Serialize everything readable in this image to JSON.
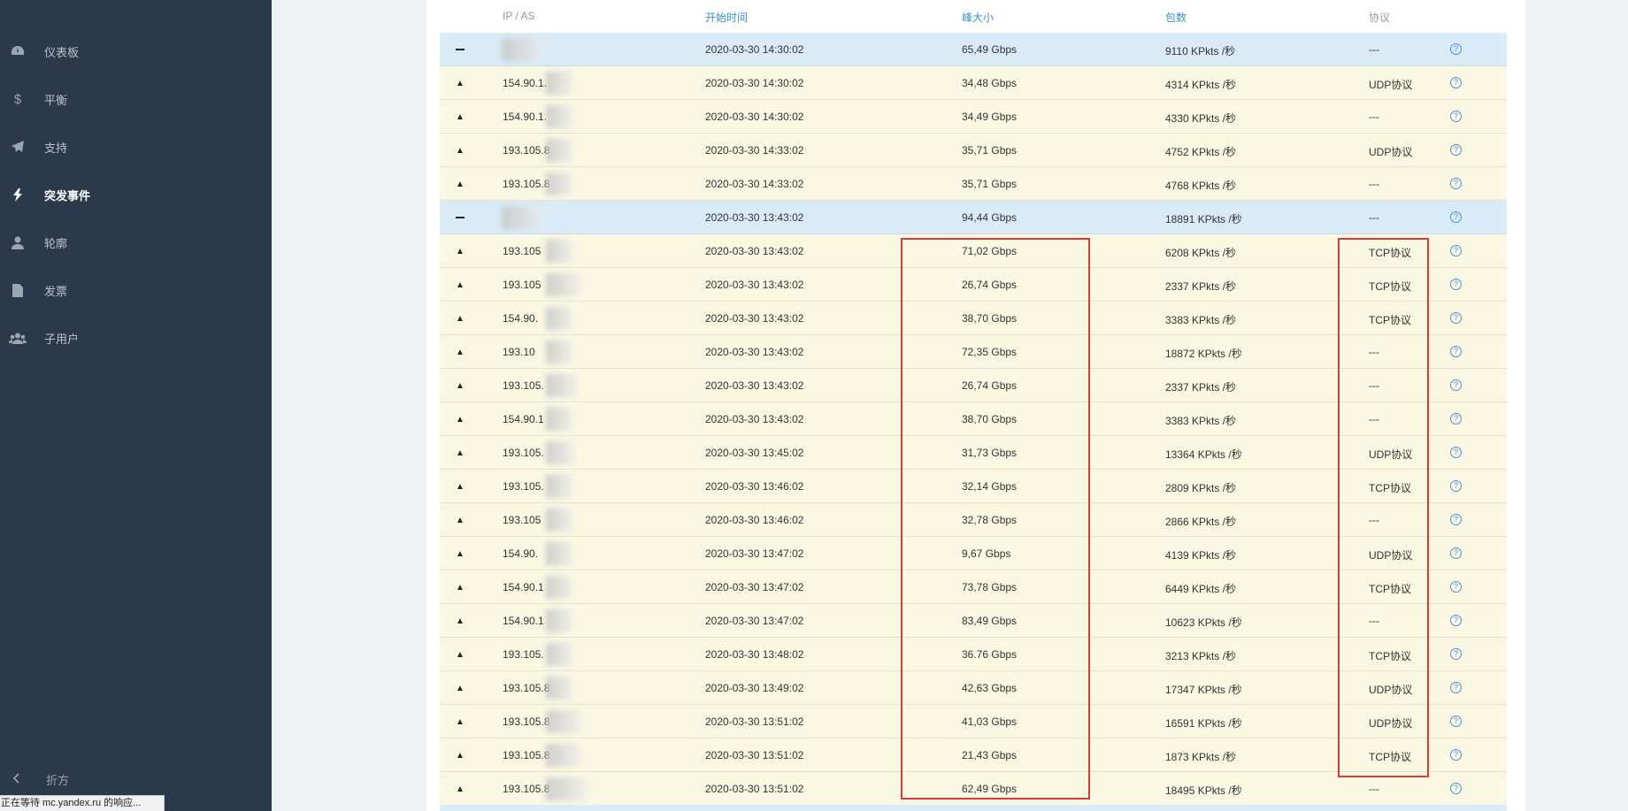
{
  "sidebar": {
    "items": [
      {
        "label": "仪表板",
        "icon": "dashboard-icon"
      },
      {
        "label": "平衡",
        "icon": "dollar-icon"
      },
      {
        "label": "支持",
        "icon": "paper-plane-icon"
      },
      {
        "label": "突发事件",
        "icon": "bolt-icon",
        "active": true
      },
      {
        "label": "轮廓",
        "icon": "user-icon"
      },
      {
        "label": "发票",
        "icon": "file-icon"
      },
      {
        "label": "子用户",
        "icon": "users-icon"
      }
    ],
    "collapse_label": "折方"
  },
  "status_text": "正在等待 mc.yandex.ru 的响应...",
  "table": {
    "headers": [
      "IP / AS",
      "开始时间",
      "峰大小",
      "包数",
      "协议"
    ],
    "rows": [
      {
        "type": "parent",
        "ip": "",
        "time": "2020-03-30 14:30:02",
        "size": "65,49 Gbps",
        "packets": "9110 KPkts /秒",
        "proto": "---"
      },
      {
        "type": "child",
        "ip": "154.90.1.",
        "time": "2020-03-30 14:30:02",
        "size": "34,48 Gbps",
        "packets": "4314 KPkts /秒",
        "proto": "UDP协议"
      },
      {
        "type": "child",
        "ip": "154.90.1.",
        "time": "2020-03-30 14:30:02",
        "size": "34,49 Gbps",
        "packets": "4330 KPkts /秒",
        "proto": "---"
      },
      {
        "type": "child",
        "ip": "193.105.8",
        "time": "2020-03-30 14:33:02",
        "size": "35,71 Gbps",
        "packets": "4752 KPkts /秒",
        "proto": "UDP协议"
      },
      {
        "type": "child",
        "ip": "193.105.8",
        "time": "2020-03-30 14:33:02",
        "size": "35,71 Gbps",
        "packets": "4768 KPkts /秒",
        "proto": "---"
      },
      {
        "type": "parent",
        "ip": "",
        "time": "2020-03-30 13:43:02",
        "size": "94,44 Gbps",
        "packets": "18891 KPkts /秒",
        "proto": "---"
      },
      {
        "type": "child",
        "ip": "193.105",
        "time": "2020-03-30 13:43:02",
        "size": "71,02 Gbps",
        "packets": "6208 KPkts /秒",
        "proto": "TCP协议"
      },
      {
        "type": "child",
        "ip": "193.105",
        "time": "2020-03-30 13:43:02",
        "size": "26,74 Gbps",
        "packets": "2337 KPkts /秒",
        "proto": "TCP协议"
      },
      {
        "type": "child",
        "ip": "154.90.",
        "time": "2020-03-30 13:43:02",
        "size": "38,70 Gbps",
        "packets": "3383 KPkts /秒",
        "proto": "TCP协议"
      },
      {
        "type": "child",
        "ip": "193.10",
        "time": "2020-03-30 13:43:02",
        "size": "72,35 Gbps",
        "packets": "18872 KPkts /秒",
        "proto": "---"
      },
      {
        "type": "child",
        "ip": "193.105.",
        "time": "2020-03-30 13:43:02",
        "size": "26,74 Gbps",
        "packets": "2337 KPkts /秒",
        "proto": "---"
      },
      {
        "type": "child",
        "ip": "154.90.1",
        "time": "2020-03-30 13:43:02",
        "size": "38,70 Gbps",
        "packets": "3383 KPkts /秒",
        "proto": "---"
      },
      {
        "type": "child",
        "ip": "193.105.",
        "time": "2020-03-30 13:45:02",
        "size": "31,73 Gbps",
        "packets": "13364 KPkts /秒",
        "proto": "UDP协议"
      },
      {
        "type": "child",
        "ip": "193.105.",
        "time": "2020-03-30 13:46:02",
        "size": "32,14 Gbps",
        "packets": "2809 KPkts /秒",
        "proto": "TCP协议"
      },
      {
        "type": "child",
        "ip": "193.105",
        "time": "2020-03-30 13:46:02",
        "size": "32,78 Gbps",
        "packets": "2866 KPkts /秒",
        "proto": "---"
      },
      {
        "type": "child",
        "ip": "154.90.",
        "time": "2020-03-30 13:47:02",
        "size": "9,67 Gbps",
        "packets": "4139 KPkts /秒",
        "proto": "UDP协议"
      },
      {
        "type": "child",
        "ip": "154.90.1",
        "time": "2020-03-30 13:47:02",
        "size": "73,78 Gbps",
        "packets": "6449 KPkts /秒",
        "proto": "TCP协议"
      },
      {
        "type": "child",
        "ip": "154.90.1",
        "time": "2020-03-30 13:47:02",
        "size": "83,49 Gbps",
        "packets": "10623 KPkts /秒",
        "proto": "---"
      },
      {
        "type": "child",
        "ip": "193.105.",
        "time": "2020-03-30 13:48:02",
        "size": "36.76 Gbps",
        "packets": "3213 KPkts /秒",
        "proto": "TCP协议"
      },
      {
        "type": "child",
        "ip": "193.105.8",
        "time": "2020-03-30 13:49:02",
        "size": "42,63 Gbps",
        "packets": "17347 KPkts /秒",
        "proto": "UDP协议"
      },
      {
        "type": "child",
        "ip": "193.105.8",
        "time": "2020-03-30 13:51:02",
        "size": "41,03 Gbps",
        "packets": "16591 KPkts /秒",
        "proto": "UDP协议"
      },
      {
        "type": "child",
        "ip": "193.105.8",
        "time": "2020-03-30 13:51:02",
        "size": "21,43 Gbps",
        "packets": "1873 KPkts /秒",
        "proto": "TCP协议"
      },
      {
        "type": "child",
        "ip": "193.105.8",
        "time": "2020-03-30 13:51:02",
        "size": "62,49 Gbps",
        "packets": "18495 KPkts /秒",
        "proto": "---"
      }
    ]
  }
}
